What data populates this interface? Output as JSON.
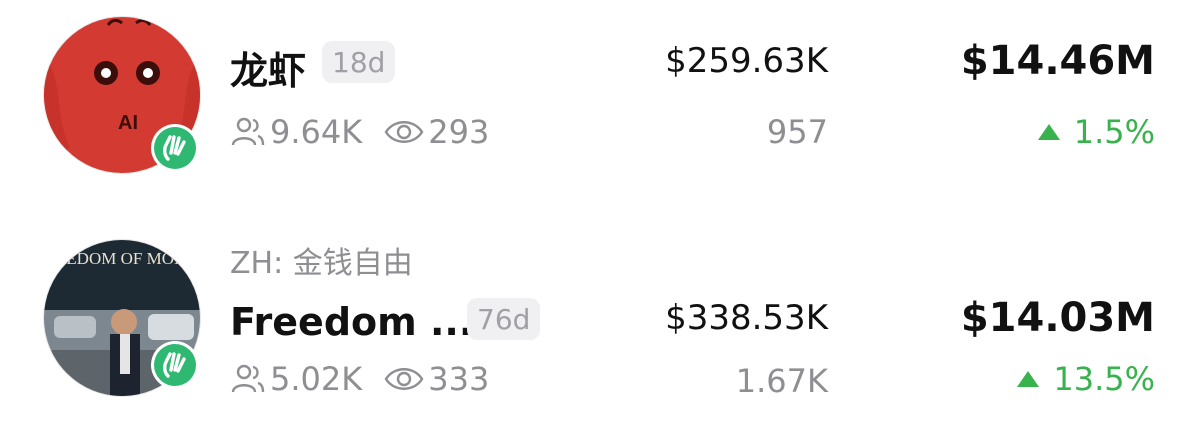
{
  "items": [
    {
      "subtitle": "",
      "title": "龙虾",
      "age": "18d",
      "holders": "9.64K",
      "views": "293",
      "volume": "$259.63K",
      "count": "957",
      "market_cap": "$14.46M",
      "change": "1.5%",
      "avatar_label": "AI"
    },
    {
      "subtitle": "ZH: 金钱自由",
      "title": "Freedom ...",
      "age": "76d",
      "holders": "5.02K",
      "views": "333",
      "volume": "$338.53K",
      "count": "1.67K",
      "market_cap": "$14.03M",
      "change": "13.5%",
      "avatar_label": "FREEDOM OF MONEY"
    }
  ],
  "colors": {
    "positive": "#37b24d",
    "muted": "#8e8e93",
    "badge": "#2eb872",
    "avatar1_bg": "#d23a32"
  },
  "icons": {
    "holders": "people-icon",
    "views": "eye-icon",
    "verified": "waving-hand-icon",
    "trend": "triangle-up-icon"
  }
}
